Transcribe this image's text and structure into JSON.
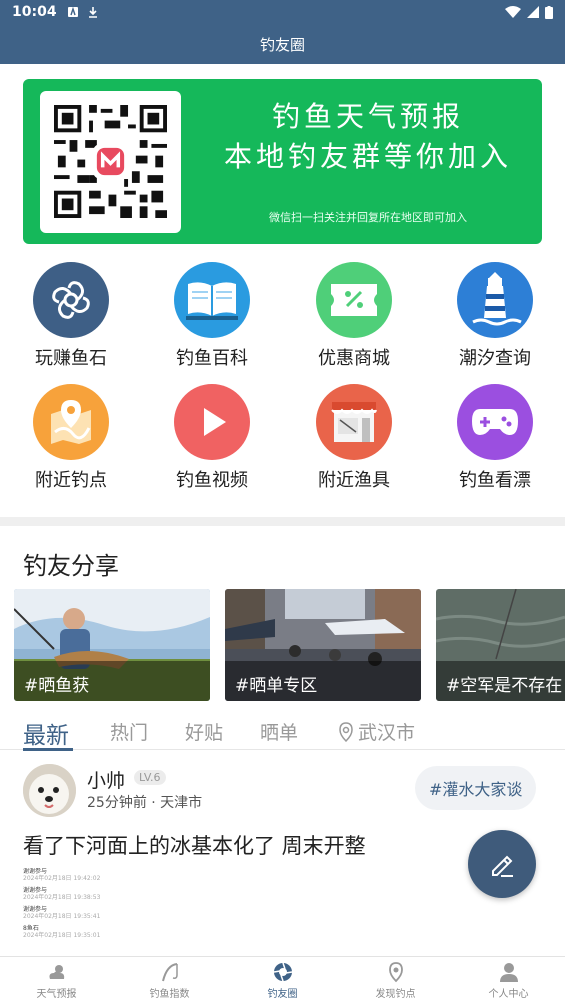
{
  "status": {
    "time": "10:04"
  },
  "header": {
    "title": "钓友圈"
  },
  "banner": {
    "line1": "钓鱼天气预报",
    "line2": "本地钓友群等你加入",
    "note": "微信扫一扫关注并回复所在地区即可加入"
  },
  "grid": [
    {
      "label": "玩赚鱼石",
      "icon": "fish-stone-icon",
      "color": "#3e5f86"
    },
    {
      "label": "钓鱼百科",
      "icon": "book-icon",
      "color": "#2a9be0"
    },
    {
      "label": "优惠商城",
      "icon": "coupon-icon",
      "color": "#4fcf79"
    },
    {
      "label": "潮汐查询",
      "icon": "lighthouse-icon",
      "color": "#2d7fd6"
    },
    {
      "label": "附近钓点",
      "icon": "map-pin-icon",
      "color": "#f7a23b"
    },
    {
      "label": "钓鱼视频",
      "icon": "play-icon",
      "color": "#f06262"
    },
    {
      "label": "附近渔具",
      "icon": "shop-icon",
      "color": "#e9644a"
    },
    {
      "label": "钓鱼看漂",
      "icon": "gamepad-icon",
      "color": "#9b4fe0"
    }
  ],
  "section": {
    "title": "钓友分享"
  },
  "shares": [
    {
      "tag": "#晒鱼获"
    },
    {
      "tag": "#晒单专区"
    },
    {
      "tag": "#空军是不存在"
    }
  ],
  "tabs": [
    {
      "label": "最新"
    },
    {
      "label": "热门"
    },
    {
      "label": "好贴"
    },
    {
      "label": "晒单"
    },
    {
      "label": "武汉市"
    }
  ],
  "post": {
    "username": "小帅",
    "level": "LV.6",
    "meta": "25分钟前 · 天津市",
    "topic": "#灌水大家谈",
    "text": "看了下河面上的冰基本化了 周末开整",
    "image_lines": [
      "谢谢参与",
      "2024年02月18日 19:42:02",
      "谢谢参与",
      "2024年02月18日 19:38:53",
      "谢谢参与",
      "2024年02月18日 19:35:41",
      "8鱼石",
      "2024年02月18日 19:35:01"
    ]
  },
  "nav": [
    {
      "label": "天气预报",
      "icon": "weather-icon"
    },
    {
      "label": "钓鱼指数",
      "icon": "fishing-rod-icon"
    },
    {
      "label": "钓友圈",
      "icon": "camera-aperture-icon"
    },
    {
      "label": "发现钓点",
      "icon": "location-icon"
    },
    {
      "label": "个人中心",
      "icon": "user-icon"
    }
  ]
}
